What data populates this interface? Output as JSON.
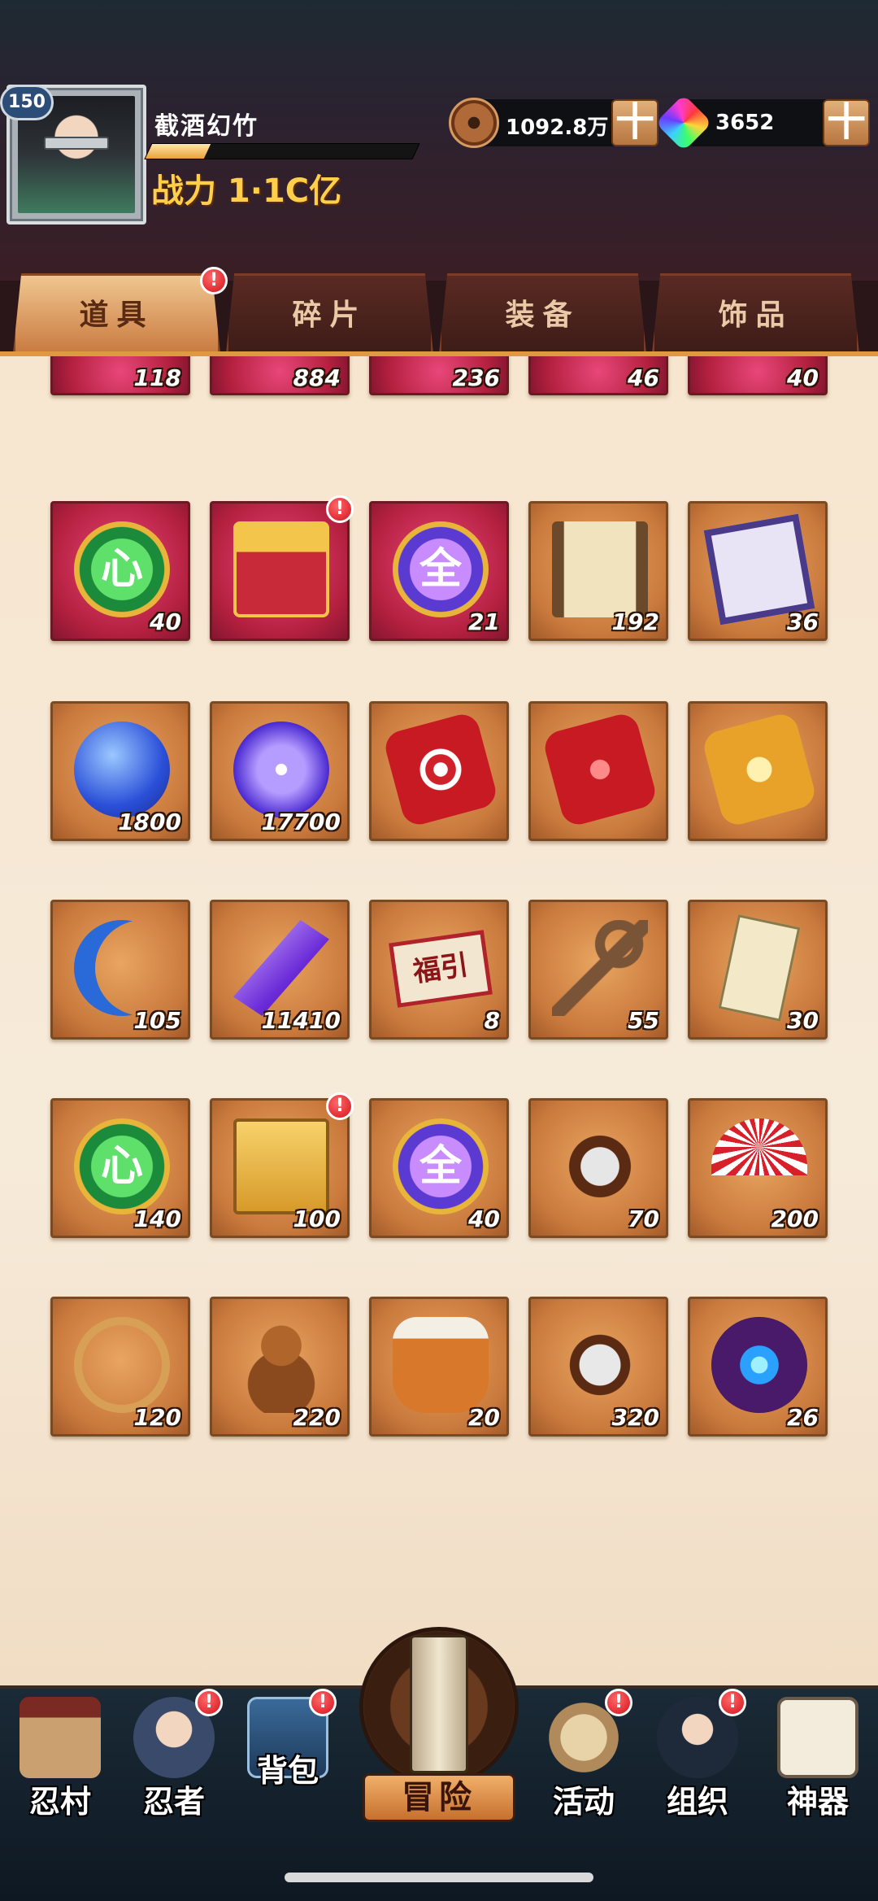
{
  "player": {
    "level": "150",
    "name": "截酒幻竹",
    "power": "战力 1·1C亿",
    "exp_fraction": 0.22
  },
  "currency": {
    "copper_value": "1092.8万",
    "crystal_value": "3652",
    "plus_label": "十"
  },
  "tabs": [
    {
      "label": "道具",
      "active": true,
      "badge": "!"
    },
    {
      "label": "碎片",
      "active": false
    },
    {
      "label": "装备",
      "active": false
    },
    {
      "label": "饰品",
      "active": false
    }
  ],
  "inventory": {
    "row0": [
      {
        "count": "118",
        "icon": "scroll-icon"
      },
      {
        "count": "884",
        "icon": "scroll-icon"
      },
      {
        "count": "236",
        "icon": "scroll-icon"
      },
      {
        "count": "46",
        "icon": "scroll-icon"
      },
      {
        "count": "40",
        "icon": "scroll-icon"
      }
    ],
    "row1": [
      {
        "count": "40",
        "icon": "heart-jade-icon",
        "glyph": "心"
      },
      {
        "count": "",
        "icon": "gold-gift-box-icon",
        "badge": "!"
      },
      {
        "count": "21",
        "icon": "all-jade-icon",
        "glyph": "全"
      },
      {
        "count": "192",
        "icon": "scroll-map-icon"
      },
      {
        "count": "36",
        "icon": "seal-paper-icon"
      }
    ],
    "row2": [
      {
        "count": "1800",
        "icon": "blue-orb-icon"
      },
      {
        "count": "17700",
        "icon": "purple-orb-icon"
      },
      {
        "count": "",
        "icon": "red-target-stone-icon"
      },
      {
        "count": "",
        "icon": "red-eye-stone-icon"
      },
      {
        "count": "",
        "icon": "gold-stone-icon"
      }
    ],
    "row3": [
      {
        "count": "105",
        "icon": "blue-moon-icon"
      },
      {
        "count": "11410",
        "icon": "purple-crystal-icon"
      },
      {
        "count": "8",
        "icon": "fortune-card-icon",
        "glyph": "福引"
      },
      {
        "count": "55",
        "icon": "key-icon"
      },
      {
        "count": "30",
        "icon": "talisman-icon"
      }
    ],
    "row4": [
      {
        "count": "140",
        "icon": "heart-jade-icon",
        "glyph": "心"
      },
      {
        "count": "100",
        "icon": "gold-box-icon",
        "badge": "!"
      },
      {
        "count": "40",
        "icon": "all-jade-icon",
        "glyph": "全"
      },
      {
        "count": "70",
        "icon": "shuriken-icon"
      },
      {
        "count": "200",
        "icon": "war-fan-icon"
      }
    ],
    "row5": [
      {
        "count": "120",
        "icon": "rope-icon"
      },
      {
        "count": "220",
        "icon": "gourd-icon"
      },
      {
        "count": "20",
        "icon": "jar-icon"
      },
      {
        "count": "320",
        "icon": "kunai-bundle-icon"
      },
      {
        "count": "26",
        "icon": "spirit-flame-orb-icon"
      }
    ]
  },
  "nav": {
    "village": "忍村",
    "ninja": "忍者",
    "bag": "背包",
    "adventure": "冒险",
    "activity": "活动",
    "organization": "组织",
    "artifact": "神器",
    "badge": "!"
  }
}
